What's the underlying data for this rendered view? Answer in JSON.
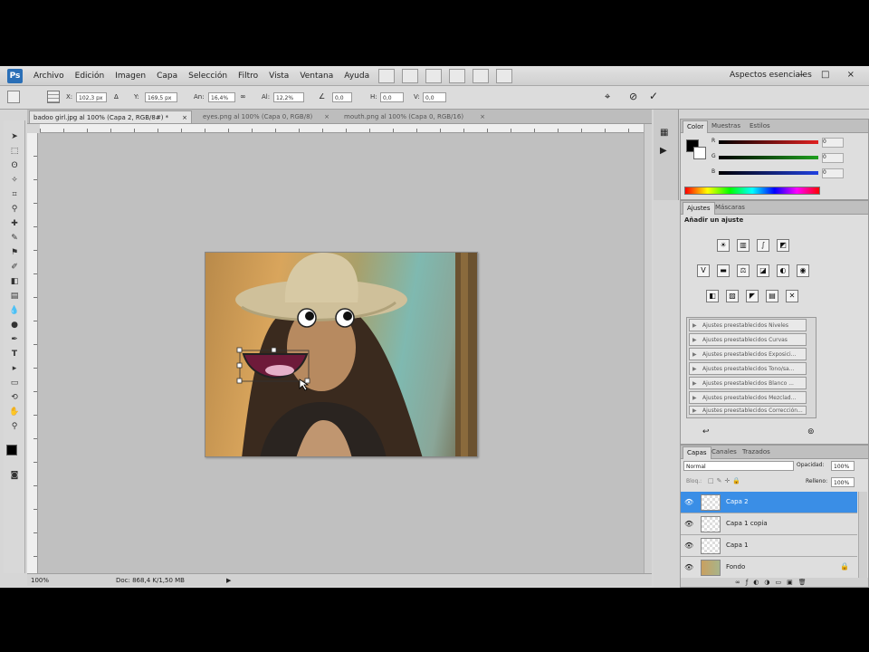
{
  "app": {
    "logo": "Ps",
    "menu": [
      "Archivo",
      "Edición",
      "Imagen",
      "Capa",
      "Selección",
      "Filtro",
      "Vista",
      "Ventana",
      "Ayuda"
    ],
    "workspace": "Aspectos esenciales",
    "window_controls": "– □ ×"
  },
  "options": {
    "x_label": "X:",
    "x_value": "102,3 px",
    "y_label": "Y:",
    "y_value": "169,5 px",
    "w_label": "An:",
    "w_value": "16,4%",
    "h_label": "Al:",
    "h_value": "12,2%",
    "angle_value": "0,0",
    "hskew_label": "H:",
    "hskew_value": "0,0",
    "vskew_label": "V:",
    "vskew_value": "0,0"
  },
  "doc_tabs": [
    {
      "label": "badoo girl.jpg al 100% (Capa 2, RGB/8#) *",
      "close": "×"
    },
    {
      "label": "eyes.png al 100% (Capa 0, RGB/8)",
      "close": "×"
    },
    {
      "label": "mouth.png al 100% (Capa 0, RGB/16)",
      "close": "×"
    }
  ],
  "status": {
    "zoom": "100%",
    "doc": "Doc: 868,4 K/1,50 MB"
  },
  "color_panel": {
    "tabs": [
      "Color",
      "Muestras",
      "Estilos"
    ],
    "channels": [
      {
        "label": "R",
        "color": "#e02020"
      },
      {
        "label": "G",
        "color": "#20a020"
      },
      {
        "label": "B",
        "color": "#2040e0"
      }
    ],
    "values": [
      "0",
      "0",
      "0"
    ]
  },
  "adjustments_panel": {
    "tabs": [
      "Ajustes",
      "Máscaras"
    ],
    "heading": "Añadir un ajuste",
    "presets": [
      "Ajustes preestablecidos Niveles",
      "Ajustes preestablecidos Curvas",
      "Ajustes preestablecidos Exposici...",
      "Ajustes preestablecidos Tono/sa...",
      "Ajustes preestablecidos Blanco ...",
      "Ajustes preestablecidos Mezclad...",
      "Ajustes preestablecidos Corrección..."
    ]
  },
  "layers_panel": {
    "tabs": [
      "Capas",
      "Canales",
      "Trazados"
    ],
    "blend_mode": "Normal",
    "opacity_label": "Opacidad:",
    "opacity_value": "100%",
    "lock_label": "Bloq.:",
    "fill_label": "Relleno:",
    "fill_value": "100%",
    "layers": [
      {
        "name": "Capa 2",
        "selected": true
      },
      {
        "name": "Capa 1 copia",
        "selected": false
      },
      {
        "name": "Capa 1",
        "selected": false
      },
      {
        "name": "Fondo",
        "selected": false
      }
    ]
  }
}
